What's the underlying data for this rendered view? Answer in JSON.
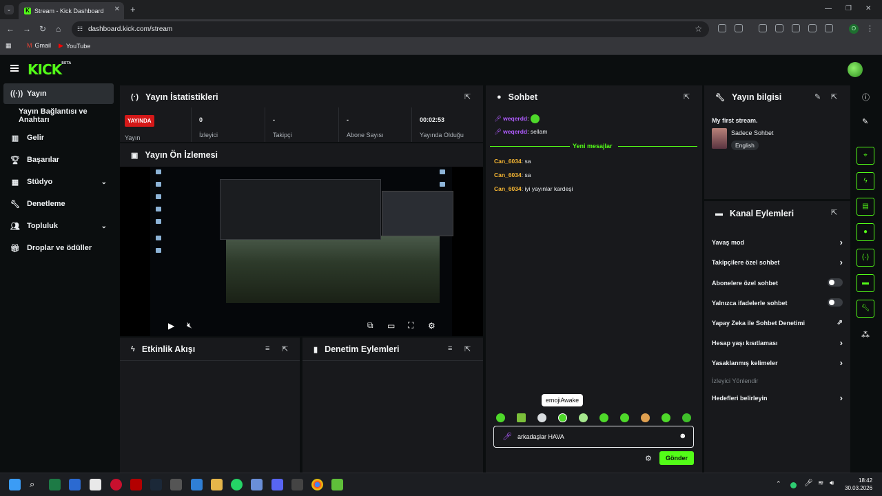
{
  "browser": {
    "tab_title": "Stream - Kick Dashboard",
    "url": "dashboard.kick.com/stream",
    "bookmarks": [
      "Gmail",
      "YouTube"
    ]
  },
  "app": {
    "logo": "KICK",
    "logo_badge": "BETA"
  },
  "sidebar": {
    "items": [
      {
        "label": "Yayın",
        "icon": "broadcast-icon"
      },
      {
        "label": "Yayın Bağlantısı ve Anahtarı"
      },
      {
        "label": "Gelir",
        "icon": "chart-icon"
      },
      {
        "label": "Başarılar",
        "icon": "trophy-icon"
      },
      {
        "label": "Stüdyo",
        "icon": "studio-icon"
      },
      {
        "label": "Denetleme",
        "icon": "wrench-icon"
      },
      {
        "label": "Topluluk",
        "icon": "people-icon"
      },
      {
        "label": "Droplar ve ödüller",
        "icon": "gift-icon"
      }
    ]
  },
  "stats": {
    "title": "Yayın İstatistikleri",
    "live_badge": "YAYINDA",
    "live_label": "Yayın",
    "items": [
      {
        "value": "0",
        "label": "İzleyici"
      },
      {
        "value": "-",
        "label": "Takipçi"
      },
      {
        "value": "-",
        "label": "Abone Sayısı"
      },
      {
        "value": "00:02:53",
        "label": "Yayında Olduğu"
      }
    ]
  },
  "preview": {
    "title": "Yayın Ön İzlemesi"
  },
  "activity": {
    "title": "Etkinlik Akışı"
  },
  "moderation": {
    "title": "Denetim Eylemleri"
  },
  "chat": {
    "title": "Sohbet",
    "messages_top": [
      {
        "user": "weqerdd",
        "text": ""
      },
      {
        "user": "weqerdd",
        "text": "sellam"
      }
    ],
    "new_messages_label": "Yeni mesajlar",
    "messages": [
      {
        "user": "Can_6034",
        "text": "sa"
      },
      {
        "user": "Can_6034",
        "text": "sa"
      },
      {
        "user": "Can_6034",
        "text": "iyi yayınlar kardeşi"
      }
    ],
    "tooltip": "emojiAwake",
    "input_value": "arkadaşlar HAVA",
    "send_label": "Gönder",
    "colors": {
      "user_top": "#b05cff",
      "user": "#f7b733",
      "accent": "#53fc18"
    }
  },
  "stream_info": {
    "title": "Yayın bilgisi",
    "stream_title": "My first stream.",
    "category": "Sadece Sohbet",
    "language": "English"
  },
  "channel_actions": {
    "title": "Kanal Eylemleri",
    "items": [
      {
        "label": "Yavaş mod",
        "control": "arrow"
      },
      {
        "label": "Takipçilere özel sohbet",
        "control": "arrow"
      },
      {
        "label": "Abonelere özel sohbet",
        "control": "toggle"
      },
      {
        "label": "Yalnızca ifadelerle sohbet",
        "control": "toggle"
      },
      {
        "label": "Yapay Zeka ile Sohbet Denetimi",
        "control": "external"
      },
      {
        "label": "Hesap yaşı kısıtlaması",
        "control": "arrow"
      },
      {
        "label": "Yasaklanmış kelimeler",
        "control": "arrow"
      }
    ],
    "section_label": "İzleyici Yönlendir",
    "goals_label": "Hedefleri belirleyin"
  },
  "taskbar": {
    "time": "18:42",
    "date": "30.03.2026"
  }
}
